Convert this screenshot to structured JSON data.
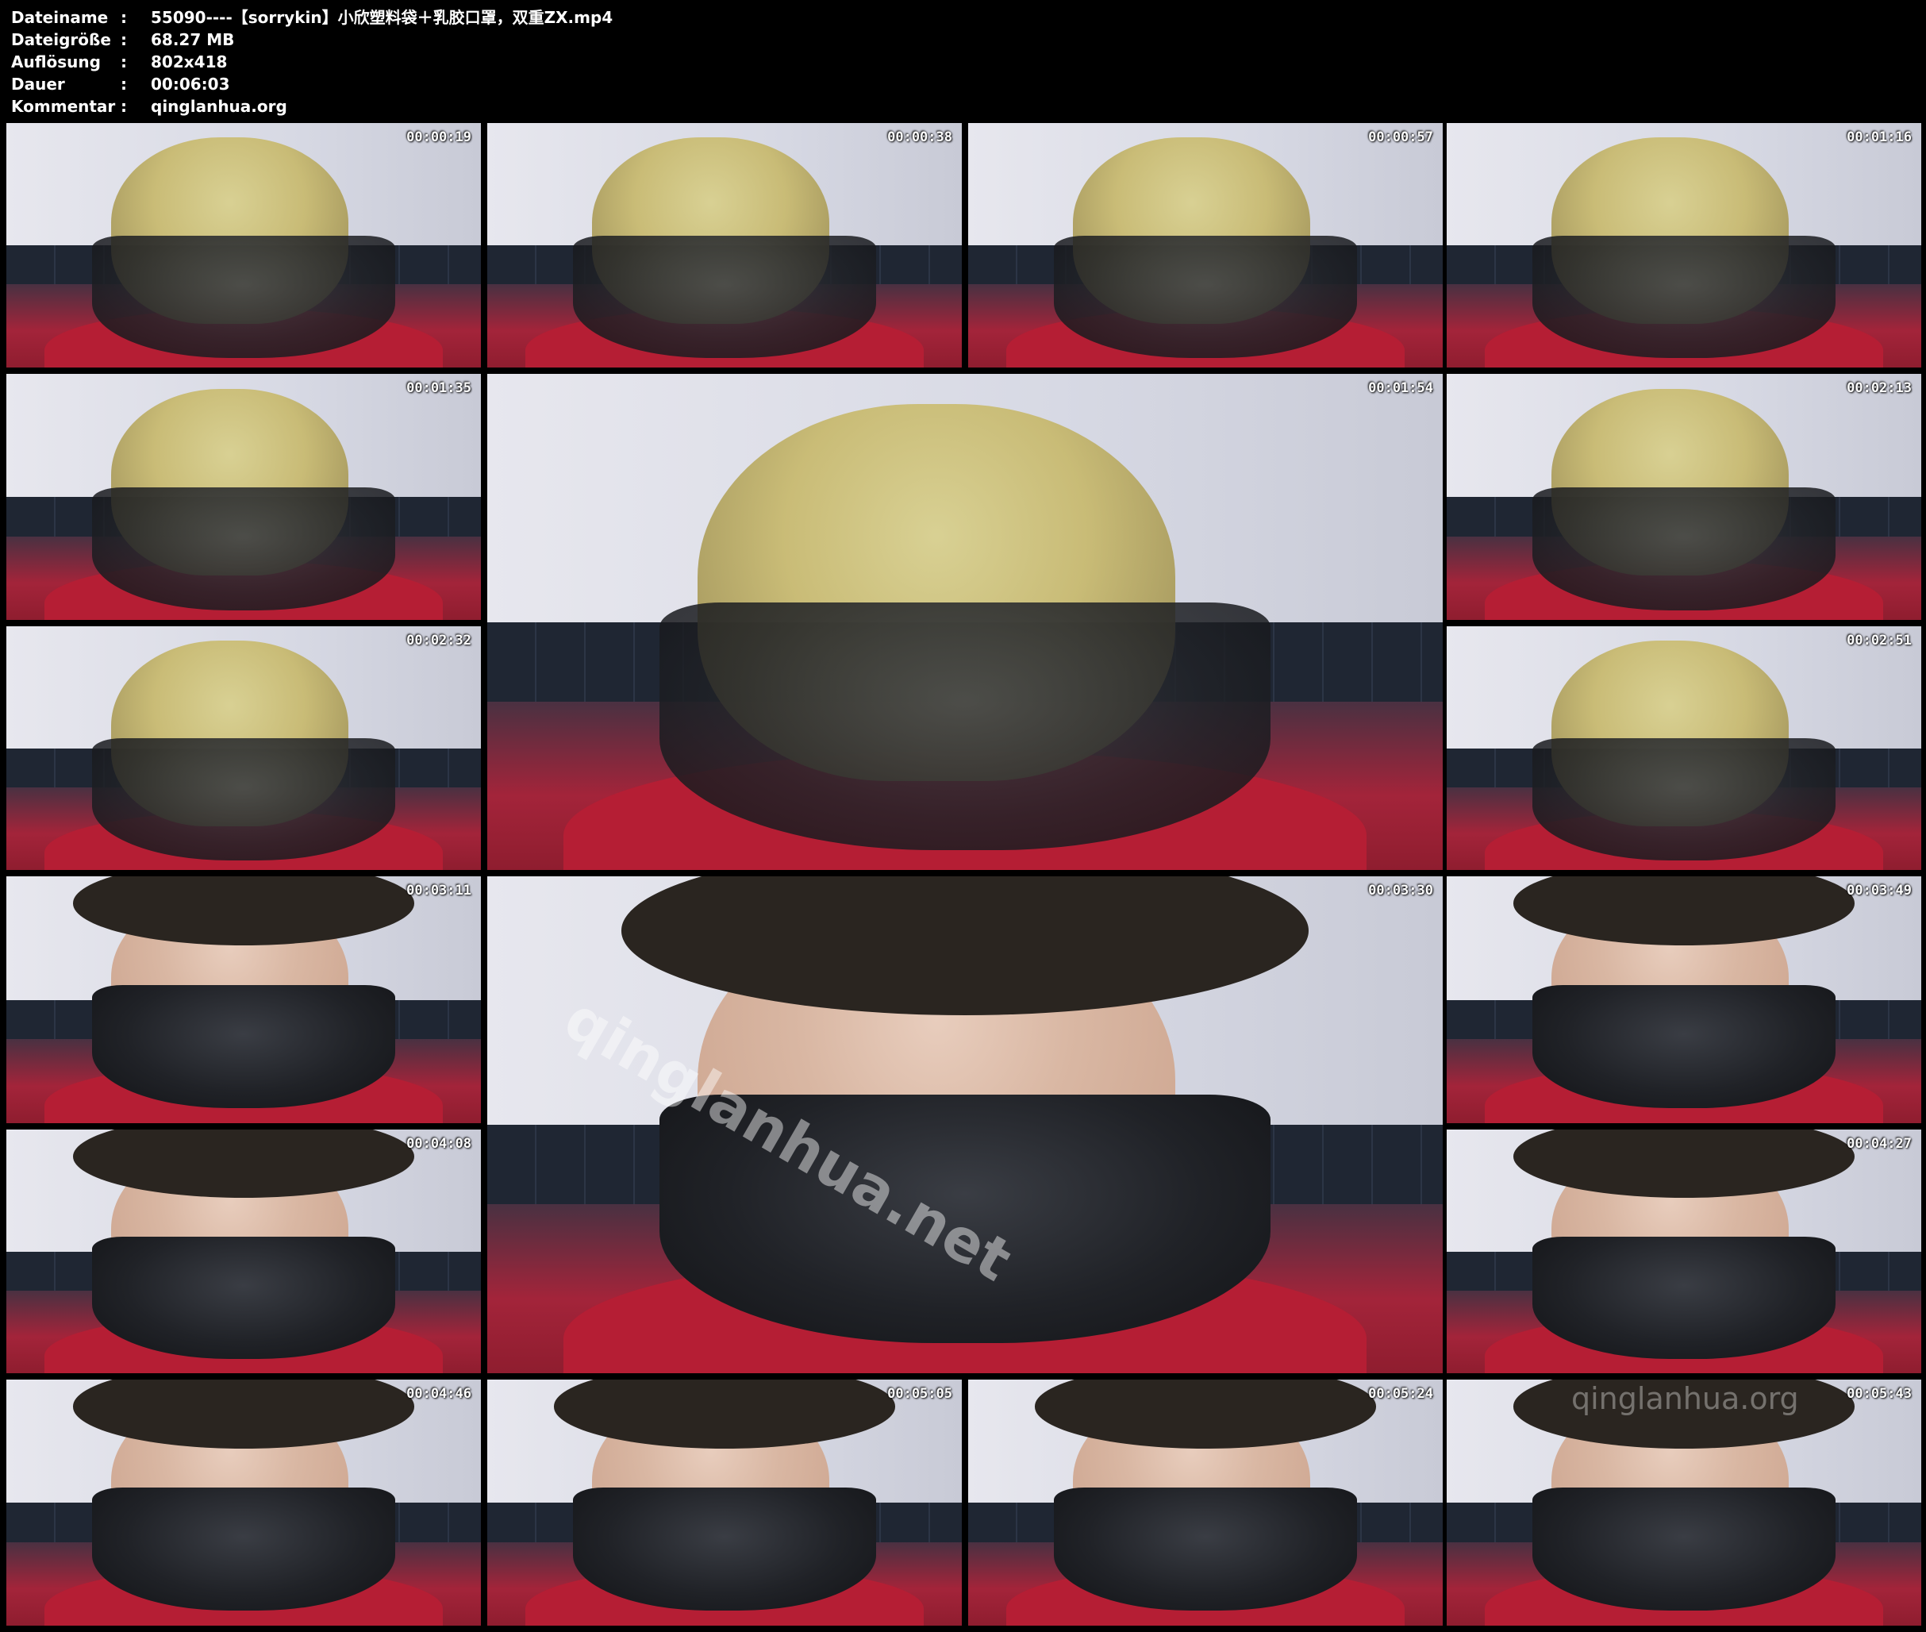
{
  "meta": [
    {
      "key": "Dateiname",
      "value": "55090----【sorrykin】小欣塑料袋＋乳胶口罩，双重ZX.mp4"
    },
    {
      "key": "Dateigröße",
      "value": "68.27 MB"
    },
    {
      "key": "Auflösung",
      "value": "802x418"
    },
    {
      "key": "Dauer",
      "value": "00:06:03"
    },
    {
      "key": "Kommentar",
      "value": "qinglanhua.org"
    }
  ],
  "separator": ":",
  "frames": [
    {
      "ts": "00:00:19",
      "kind": "bag"
    },
    {
      "ts": "00:00:38",
      "kind": "bag"
    },
    {
      "ts": "00:00:57",
      "kind": "bag"
    },
    {
      "ts": "00:01:16",
      "kind": "bag"
    },
    {
      "ts": "00:01:35",
      "kind": "bag"
    },
    {
      "ts": "00:01:54",
      "kind": "bag"
    },
    {
      "ts": "00:02:13",
      "kind": "bag"
    },
    {
      "ts": "00:02:32",
      "kind": "bag"
    },
    {
      "ts": "00:02:51",
      "kind": "bag"
    },
    {
      "ts": "00:03:11",
      "kind": "mask"
    },
    {
      "ts": "00:03:30",
      "kind": "mask"
    },
    {
      "ts": "00:03:49",
      "kind": "mask"
    },
    {
      "ts": "00:04:08",
      "kind": "mask"
    },
    {
      "ts": "00:04:27",
      "kind": "mask"
    },
    {
      "ts": "00:04:46",
      "kind": "mask"
    },
    {
      "ts": "00:05:05",
      "kind": "mask"
    },
    {
      "ts": "00:05:24",
      "kind": "mask"
    },
    {
      "ts": "00:05:43",
      "kind": "mask"
    }
  ],
  "watermark": "qinglanhua.net",
  "logo_watermark": "qinglanhua.org"
}
